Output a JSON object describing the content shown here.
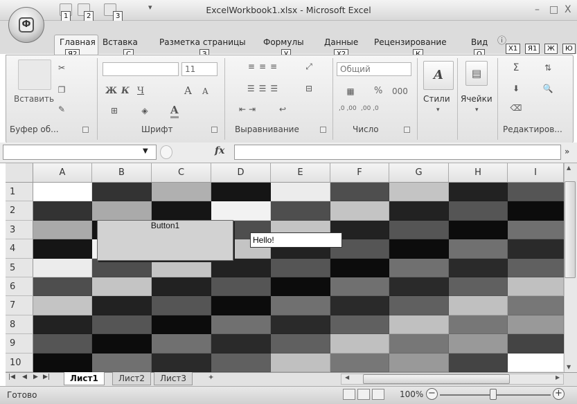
{
  "window": {
    "title": "ExcelWorkbook1.xlsx - Microsoft Excel",
    "minimize_glyph": "–",
    "maximize_glyph": "□",
    "close_glyph": "X"
  },
  "office_button": {
    "keytip": "Ф"
  },
  "quick_access": [
    {
      "name": "save-icon",
      "keytip": "1"
    },
    {
      "name": "undo-icon",
      "keytip": "2"
    },
    {
      "name": "redo-icon",
      "keytip": "3"
    }
  ],
  "tabs": [
    {
      "label": "Главная",
      "keytip": "Я2"
    },
    {
      "label": "Вставка",
      "keytip": "С"
    },
    {
      "label": "Разметка страницы",
      "keytip": "З"
    },
    {
      "label": "Формулы",
      "keytip": "У"
    },
    {
      "label": "Данные",
      "keytip": "Х2"
    },
    {
      "label": "Рецензирование",
      "keytip": "К"
    },
    {
      "label": "Вид",
      "keytip": "О"
    }
  ],
  "extra_keytips": [
    "Х1",
    "Я1",
    "Ж",
    "Ю"
  ],
  "ribbon": {
    "clipboard": {
      "paste_label": "Вставить",
      "group_label": "Буфер об..."
    },
    "font": {
      "font_name": "",
      "font_size": "11",
      "bold": "Ж",
      "italic": "К",
      "underline": "Ч",
      "grow": "A",
      "shrink": "A",
      "group_label": "Шрифт"
    },
    "alignment": {
      "group_label": "Выравнивание"
    },
    "number": {
      "format": "Общий",
      "percent": "%",
      "thousands": "000",
      "inc_decimal": ",0 ,00",
      "dec_decimal": ",00 ,0",
      "group_label": "Число"
    },
    "styles": {
      "label": "Стили"
    },
    "cells": {
      "label": "Ячейки"
    },
    "editing": {
      "group_label": "Редактиров..."
    }
  },
  "formula_bar": {
    "name_box": "",
    "fx": "fx",
    "value": ""
  },
  "grid": {
    "columns": [
      "A",
      "B",
      "C",
      "D",
      "E",
      "F",
      "G",
      "H",
      "I"
    ],
    "rows": [
      "1",
      "2",
      "3",
      "4",
      "5",
      "6",
      "7",
      "8",
      "9",
      "10"
    ],
    "cell_colors": [
      [
        "#ffffff",
        "#333333",
        "#b0b0b0",
        "#151515",
        "#ececec",
        "#4e4e4e",
        "#c4c4c4",
        "#222222",
        "#555555"
      ],
      [
        "#333333",
        "#aaaaaa",
        "#151515",
        "#f2f2f2",
        "#4e4e4e",
        "#c4c4c4",
        "#222222",
        "#555555",
        "#0c0c0c"
      ],
      [
        "#aaaaaa",
        "#151515",
        "#f2f2f2",
        "#4e4e4e",
        "#c4c4c4",
        "#222222",
        "#555555",
        "#0c0c0c",
        "#707070"
      ],
      [
        "#151515",
        "#f2f2f2",
        "#4e4e4e",
        "#c4c4c4",
        "#222222",
        "#555555",
        "#0c0c0c",
        "#707070",
        "#2a2a2a"
      ],
      [
        "#ececec",
        "#4e4e4e",
        "#c4c4c4",
        "#222222",
        "#555555",
        "#0c0c0c",
        "#707070",
        "#2a2a2a",
        "#606060"
      ],
      [
        "#4e4e4e",
        "#c4c4c4",
        "#222222",
        "#555555",
        "#0c0c0c",
        "#707070",
        "#2a2a2a",
        "#606060",
        "#c0c0c0"
      ],
      [
        "#c4c4c4",
        "#222222",
        "#555555",
        "#0c0c0c",
        "#707070",
        "#2a2a2a",
        "#606060",
        "#c0c0c0",
        "#777777"
      ],
      [
        "#222222",
        "#555555",
        "#0c0c0c",
        "#707070",
        "#2a2a2a",
        "#606060",
        "#c0c0c0",
        "#777777",
        "#999999"
      ],
      [
        "#555555",
        "#0c0c0c",
        "#707070",
        "#2a2a2a",
        "#606060",
        "#c0c0c0",
        "#777777",
        "#999999",
        "#444444"
      ],
      [
        "#0c0c0c",
        "#707070",
        "#2a2a2a",
        "#606060",
        "#c0c0c0",
        "#777777",
        "#999999",
        "#444444",
        "#ffffff"
      ]
    ]
  },
  "controls": {
    "button_label": "Button1",
    "textbox_value": "Hello!"
  },
  "sheets": [
    {
      "label": "Лист1",
      "active": true
    },
    {
      "label": "Лист2",
      "active": false
    },
    {
      "label": "Лист3",
      "active": false
    }
  ],
  "status": {
    "text": "Готово",
    "zoom": "100%"
  }
}
